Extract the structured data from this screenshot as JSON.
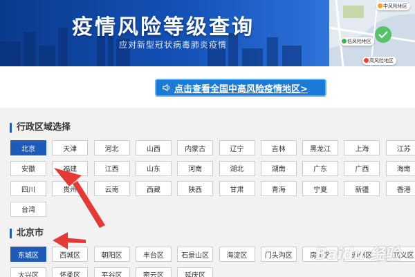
{
  "banner": {
    "title": "疫情风险等级查询",
    "subtitle": "应对新型冠状病毒肺炎疫情",
    "map_tags": {
      "mid": "中风险地区",
      "low": "低风险地区",
      "high": "高风险地区"
    }
  },
  "notice": {
    "label": "点击查看全国中高风险疫情地区>"
  },
  "province_section": {
    "title": "行政区域选择",
    "selected": "北京",
    "rows": [
      [
        "北京",
        "天津",
        "河北",
        "山西",
        "内蒙古",
        "辽宁",
        "吉林",
        "黑龙江",
        "上海",
        "江苏"
      ],
      [
        "安徽",
        "福建",
        "江西",
        "山东",
        "河南",
        "湖北",
        "湖南",
        "广东",
        "广西",
        "海南"
      ],
      [
        "四川",
        "贵州",
        "云南",
        "西藏",
        "陕西",
        "甘肃",
        "青海",
        "宁夏",
        "新疆",
        "香港"
      ],
      [
        "台湾"
      ]
    ]
  },
  "district_section": {
    "title": "北京市",
    "selected": "东城区",
    "rows": [
      [
        "东城区",
        "西城区",
        "朝阳区",
        "丰台区",
        "石景山区",
        "海淀区",
        "门头沟区",
        "房山区",
        "通州区",
        "顺义区"
      ],
      [
        "大兴区",
        "怀柔区",
        "平谷区",
        "密云区",
        "延庆区"
      ]
    ]
  },
  "watermark": "Baidu 经验",
  "colors": {
    "accent": "#1e5bb8",
    "arrow": "#e53935",
    "notice_bg": "#1a7ad6"
  }
}
